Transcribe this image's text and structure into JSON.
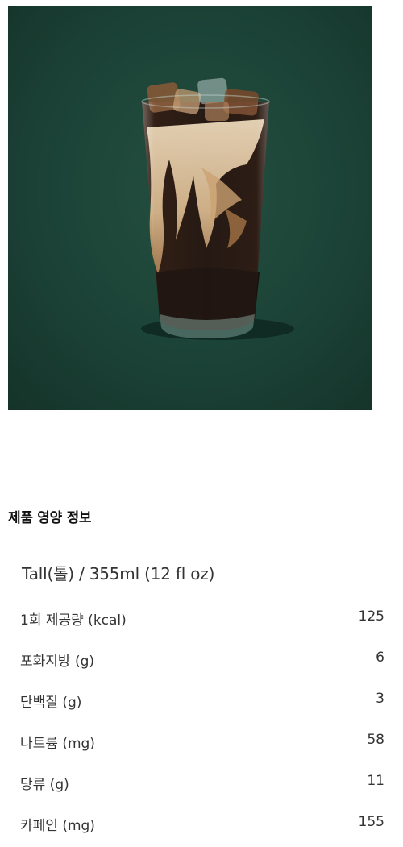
{
  "product": {
    "image_alt": "iced coffee with cream in a glass on dark green background"
  },
  "colors": {
    "background_green": "#1b4136",
    "coffee_dark": "#1a0d07",
    "cream": "#e2c7a0"
  },
  "nutrition": {
    "title": "제품 영양 정보",
    "size": "Tall(톨) / 355ml (12 fl oz)",
    "rows": [
      {
        "label": "1회 제공량 (kcal)",
        "value": "125"
      },
      {
        "label": "포화지방 (g)",
        "value": "6"
      },
      {
        "label": "단백질 (g)",
        "value": "3"
      },
      {
        "label": "나트륨 (mg)",
        "value": "58"
      },
      {
        "label": "당류 (g)",
        "value": "11"
      },
      {
        "label": "카페인 (mg)",
        "value": "155"
      }
    ]
  }
}
